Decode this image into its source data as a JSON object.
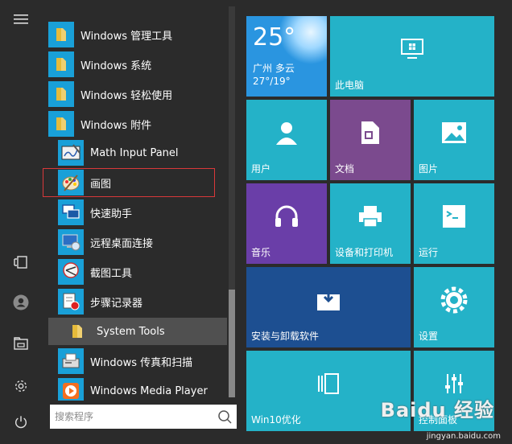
{
  "apps": {
    "folders": [
      {
        "label": "Windows 管理工具"
      },
      {
        "label": "Windows 系统"
      },
      {
        "label": "Windows 轻松使用"
      },
      {
        "label": "Windows 附件"
      }
    ],
    "items": [
      {
        "label": "Math Input Panel"
      },
      {
        "label": "画图"
      },
      {
        "label": "快速助手"
      },
      {
        "label": "远程桌面连接"
      },
      {
        "label": "截图工具"
      },
      {
        "label": "步骤记录器"
      },
      {
        "label": "System Tools"
      },
      {
        "label": "Windows 传真和扫描"
      },
      {
        "label": "Windows Media Player"
      }
    ]
  },
  "search": {
    "placeholder": "搜索程序"
  },
  "weather": {
    "temp": "25°",
    "city": "广州 多云",
    "range": "27°/19°"
  },
  "tiles": {
    "this_pc": "此电脑",
    "user": "用户",
    "documents": "文档",
    "pictures": "图片",
    "music": "音乐",
    "devices": "设备和打印机",
    "run": "运行",
    "install": "安装与卸载软件",
    "settings": "设置",
    "win10": "Win10优化",
    "control_panel": "控制面板"
  },
  "watermark": {
    "text": "Baidu 经验",
    "url": "jingyan.baidu.com"
  },
  "colors": {
    "teal": "#24b2c8",
    "purple": "#7b4a8e",
    "violet": "#6a3ea8",
    "navy": "#1d4f91",
    "folder": "#19a0d8",
    "highlight": "#d9383a"
  }
}
